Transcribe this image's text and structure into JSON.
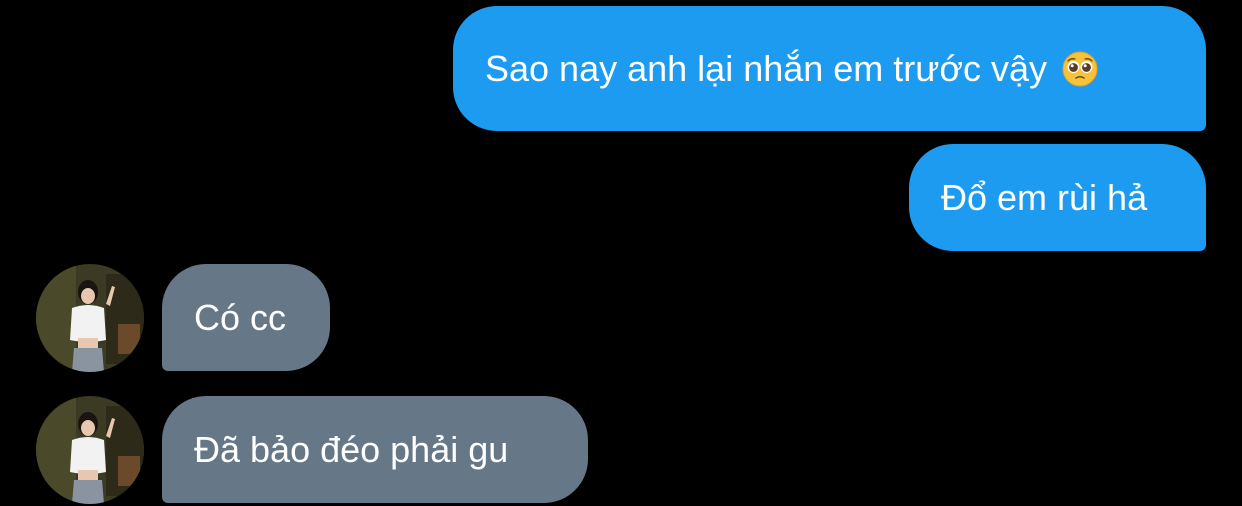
{
  "conversation": {
    "messages": [
      {
        "direction": "sent",
        "text": "Sao nay anh lại nhắn em trước vậy",
        "emoji": "pleading-face-icon"
      },
      {
        "direction": "sent",
        "text": "Đổ em rùi hả"
      },
      {
        "direction": "received",
        "text": "Có cc"
      },
      {
        "direction": "received",
        "text": "Đã bảo đéo phải gu"
      }
    ]
  },
  "colors": {
    "background": "#000000",
    "sent_bubble": "#1d9bf0",
    "received_bubble": "#667788",
    "text": "#ffffff"
  }
}
